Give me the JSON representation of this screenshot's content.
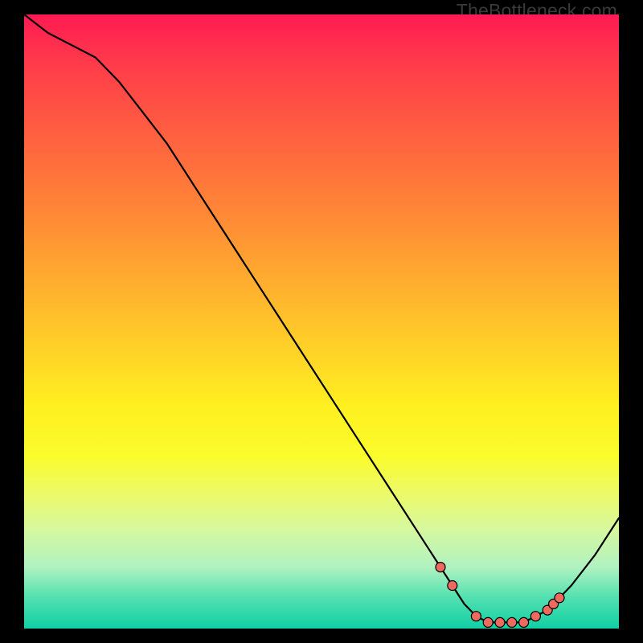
{
  "watermark": "TheBottleneck.com",
  "colors": {
    "curve": "#000000",
    "dots": "#ec6a5e",
    "frame": "#000000"
  },
  "chart_data": {
    "type": "line",
    "title": "",
    "xlabel": "",
    "ylabel": "",
    "xlim": [
      0,
      100
    ],
    "ylim": [
      0,
      100
    ],
    "series": [
      {
        "name": "bottleneck-curve",
        "x": [
          0,
          4,
          8,
          12,
          16,
          20,
          24,
          28,
          32,
          36,
          40,
          44,
          48,
          52,
          56,
          60,
          64,
          68,
          70,
          72,
          74,
          76,
          78,
          80,
          82,
          84,
          86,
          88,
          92,
          96,
          100
        ],
        "y": [
          100,
          97,
          95,
          93,
          89,
          84,
          79,
          73,
          67,
          61,
          55,
          49,
          43,
          37,
          31,
          25,
          19,
          13,
          10,
          7,
          4,
          2,
          1,
          1,
          1,
          1,
          2,
          3,
          7,
          12,
          18
        ]
      }
    ],
    "dots": [
      {
        "x": 70,
        "y": 10
      },
      {
        "x": 72,
        "y": 7
      },
      {
        "x": 76,
        "y": 2
      },
      {
        "x": 78,
        "y": 1
      },
      {
        "x": 80,
        "y": 1
      },
      {
        "x": 82,
        "y": 1
      },
      {
        "x": 84,
        "y": 1
      },
      {
        "x": 86,
        "y": 2
      },
      {
        "x": 88,
        "y": 3
      },
      {
        "x": 89,
        "y": 4
      },
      {
        "x": 90,
        "y": 5
      }
    ]
  }
}
